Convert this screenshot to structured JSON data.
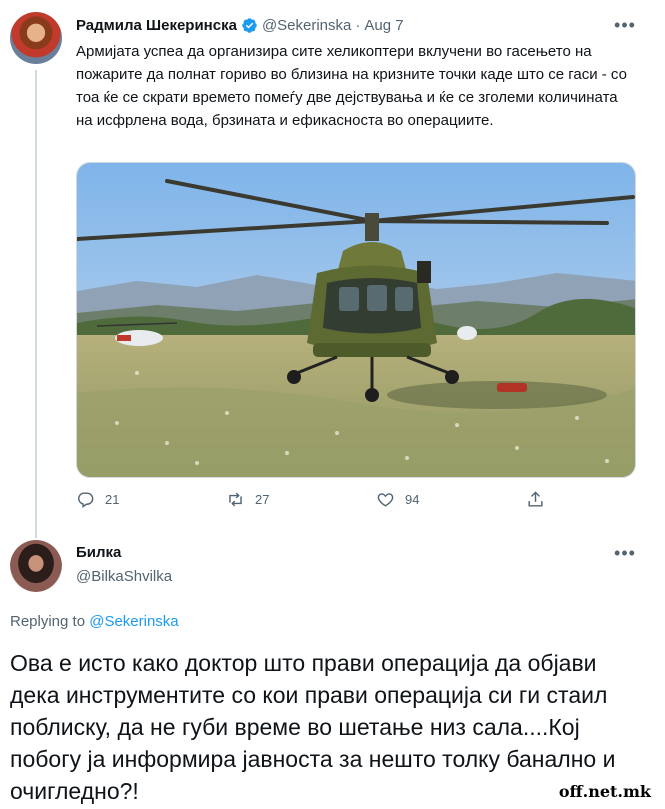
{
  "tweet": {
    "author_name": "Радмила Шекеринска",
    "handle": "@Sekerinska",
    "separator": "·",
    "date": "Aug 7",
    "more_icon": "more-horizontal-icon",
    "text": "Армијата успеа да организира сите хеликоптери вклучени во гасењето на пожарите да полнат гориво во близина на кризните точки каде што се гаси - со тоа ќе се скрати времето помеѓу две дејствувања и ќе се зголеми количината на исфрлена вода, брзината и ефикасноста во операциите.",
    "media_icon": "photo-helicopter",
    "actions": {
      "reply_count": "21",
      "retweet_count": "27",
      "like_count": "94"
    },
    "colors": {
      "verified": "#1d9bf0",
      "muted": "#536471"
    }
  },
  "reply": {
    "author_name": "Билка",
    "handle": "@BilkaShvilka",
    "replying_prefix": "Replying to",
    "replying_to": "@Sekerinska",
    "text": "Ова е исто како доктор што прави операција да објави дека инструментите со кои прави операција си ги стаил поблиску, да не губи време во шетање низ сала....Кој побогу ја информира јавноста за нешто толку банално и очигледно?!",
    "colors": {
      "link": "#1d9bf0"
    }
  },
  "watermark": "off.net.mk"
}
